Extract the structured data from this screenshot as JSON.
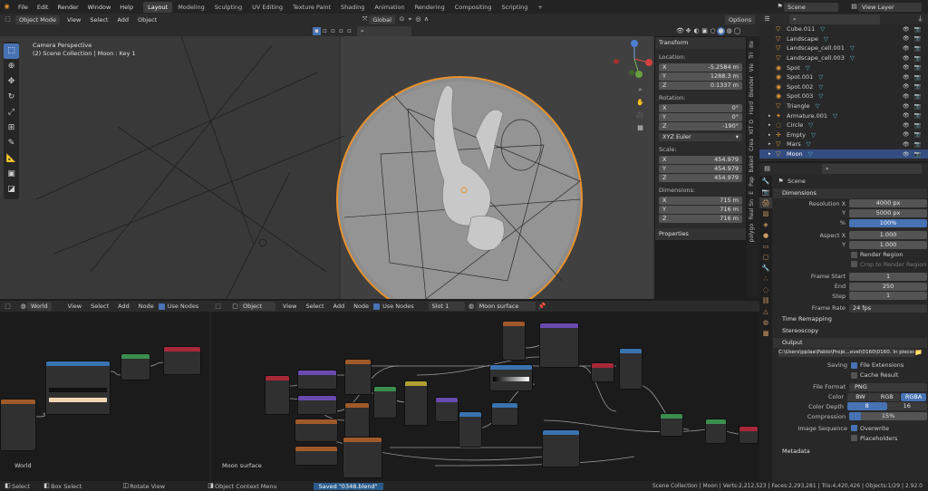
{
  "topbar": {
    "menus": [
      "File",
      "Edit",
      "Render",
      "Window",
      "Help"
    ],
    "workspaces": [
      "Layout",
      "Modeling",
      "Sculpting",
      "UV Editing",
      "Texture Paint",
      "Shading",
      "Animation",
      "Rendering",
      "Compositing",
      "Scripting"
    ],
    "active_workspace": "Layout",
    "add_tab": "+",
    "scene_name": "Scene",
    "view_layer": "View Layer"
  },
  "viewport_header": {
    "mode": "Object Mode",
    "menus": [
      "View",
      "Select",
      "Add",
      "Object"
    ],
    "orientation": "Global",
    "options": "Options"
  },
  "viewport": {
    "camera_label": "Camera Perspective",
    "collection_label": "(2) Scene Collection | Moon : Key 1"
  },
  "npanel": {
    "transform_title": "Transform",
    "location_label": "Location:",
    "location": [
      [
        "X",
        "-5.2584 m"
      ],
      [
        "Y",
        "1288.3 m"
      ],
      [
        "Z",
        "0.1337 m"
      ]
    ],
    "rotation_label": "Rotation:",
    "rotation": [
      [
        "X",
        "0°"
      ],
      [
        "Y",
        "0°"
      ],
      [
        "Z",
        "-190°"
      ]
    ],
    "rotation_mode": "XYZ Euler",
    "scale_label": "Scale:",
    "scale": [
      [
        "X",
        "454.979"
      ],
      [
        "Y",
        "454.979"
      ],
      [
        "Z",
        "454.979"
      ]
    ],
    "dimensions_label": "Dimensions:",
    "dimensions": [
      [
        "X",
        "715 m"
      ],
      [
        "Y",
        "716 m"
      ],
      [
        "Z",
        "716 m"
      ]
    ],
    "properties_title": "Properties"
  },
  "vtabs": [
    "Ite",
    "Tri",
    "Vie",
    "Blender",
    "Hard",
    "KIT O",
    "Crea",
    "Baked",
    "Pap",
    "E",
    "Real Sn",
    "polygo"
  ],
  "outliner": {
    "items": [
      {
        "name": "Cube.011",
        "icon": "mesh"
      },
      {
        "name": "Landscape",
        "icon": "mesh"
      },
      {
        "name": "Landscape_cell.001",
        "icon": "mesh"
      },
      {
        "name": "Landscape_cell.003",
        "icon": "mesh"
      },
      {
        "name": "Spot",
        "icon": "light"
      },
      {
        "name": "Spot.001",
        "icon": "light"
      },
      {
        "name": "Spot.002",
        "icon": "light"
      },
      {
        "name": "Spot.003",
        "icon": "light"
      },
      {
        "name": "Triangle",
        "icon": "mesh"
      },
      {
        "name": "Armature.001",
        "icon": "armature"
      },
      {
        "name": "Circle",
        "icon": "curve"
      },
      {
        "name": "Empty",
        "icon": "empty"
      },
      {
        "name": "Mars",
        "icon": "mesh"
      },
      {
        "name": "Moon",
        "icon": "mesh"
      }
    ],
    "selected": "Moon"
  },
  "properties": {
    "scene_label": "Scene",
    "dimensions_title": "Dimensions",
    "resolution_x_label": "Resolution X",
    "resolution_x": "4000 px",
    "resolution_y_label": "Y",
    "resolution_y": "5000 px",
    "percent_label": "%",
    "percent": "100%",
    "aspect_x_label": "Aspect X",
    "aspect_x": "1.000",
    "aspect_y_label": "Y",
    "aspect_y": "1.000",
    "render_region": "Render Region",
    "crop_region": "Crop to Render Region",
    "frame_start_label": "Frame Start",
    "frame_start": "1",
    "end_label": "End",
    "end": "250",
    "step_label": "Step",
    "step": "1",
    "frame_rate_label": "Frame Rate",
    "frame_rate": "24 fps",
    "time_remapping": "Time Remapping",
    "stereoscopy": "Stereoscopy",
    "output_title": "Output",
    "output_path": "C:\\Users\\pplaa\\Pablo\\Proje...evel\\0160\\0160. In pieces",
    "saving_label": "Saving",
    "file_extensions": "File Extensions",
    "cache_result": "Cache Result",
    "file_format_label": "File Format",
    "file_format": "PNG",
    "color_label": "Color",
    "color_options": [
      "BW",
      "RGB",
      "RGBA"
    ],
    "color_active": "RGBA",
    "color_depth_label": "Color Depth",
    "color_depth_options": [
      "8",
      "16"
    ],
    "compression_label": "Compression",
    "compression": "15%",
    "image_sequence_label": "Image Sequence",
    "overwrite": "Overwrite",
    "placeholders": "Placeholders",
    "metadata": "Metadata"
  },
  "world_node_header": {
    "type": "World",
    "menus": [
      "View",
      "Select",
      "Add",
      "Node"
    ],
    "use_nodes": "Use Nodes"
  },
  "object_node_header": {
    "type": "Object",
    "menus": [
      "View",
      "Select",
      "Add",
      "Node"
    ],
    "use_nodes": "Use Nodes",
    "slot": "Slot 1",
    "material": "Moon surface"
  },
  "node_editor": {
    "world_label": "World",
    "material_label": "Moon surface"
  },
  "statusbar": {
    "select": "Select",
    "box_select": "Box Select",
    "rotate_view": "Rotate View",
    "context_menu": "Object Context Menu",
    "saved": "Saved \"0348.blend\"",
    "stats": "Scene Collection | Moon | Verts:2,212,523 | Faces:2,293,281 | Tris:4,420,426 | Objects:1/29 | 2.92.0"
  },
  "colors": {
    "accent": "#4772b3",
    "selection_orange": "#e8912d",
    "panel": "#2b2b2b",
    "background": "#1d1d1d"
  }
}
